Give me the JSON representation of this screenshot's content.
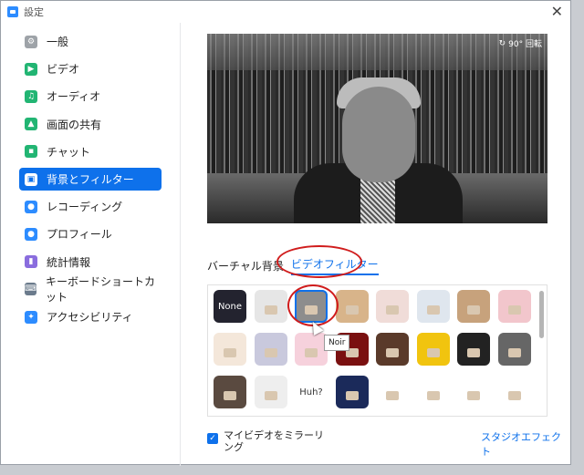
{
  "window": {
    "title": "設定",
    "close_glyph": "✕"
  },
  "sidebar": {
    "items": [
      {
        "label": "一般",
        "icon": "gear-icon",
        "color": "#9ea3a8",
        "glyph": "⚙"
      },
      {
        "label": "ビデオ",
        "icon": "video-camera-icon",
        "color": "#22b573",
        "glyph": "▶"
      },
      {
        "label": "オーディオ",
        "icon": "headphones-icon",
        "color": "#22b573",
        "glyph": "♫"
      },
      {
        "label": "画面の共有",
        "icon": "share-screen-icon",
        "color": "#22b573",
        "glyph": "▲"
      },
      {
        "label": "チャット",
        "icon": "chat-bubble-icon",
        "color": "#22b573",
        "glyph": "▪"
      },
      {
        "label": "背景とフィルター",
        "icon": "background-person-icon",
        "color": "#ffffff",
        "glyph": "▣",
        "active": true
      },
      {
        "label": "レコーディング",
        "icon": "record-icon",
        "color": "#2d8cff",
        "glyph": "●"
      },
      {
        "label": "プロフィール",
        "icon": "profile-icon",
        "color": "#2d8cff",
        "glyph": "●"
      },
      {
        "label": "統計情報",
        "icon": "statistics-icon",
        "color": "#8a6dde",
        "glyph": "▮"
      },
      {
        "label": "キーボードショートカット",
        "icon": "keyboard-icon",
        "color": "#6b7b8c",
        "glyph": "⌨"
      },
      {
        "label": "アクセシビリティ",
        "icon": "accessibility-icon",
        "color": "#2d8cff",
        "glyph": "✦"
      }
    ]
  },
  "preview": {
    "rotate_label": "90° 回転"
  },
  "tabs": {
    "virtual_background": "バーチャル背景",
    "video_filter": "ビデオフィルター"
  },
  "filters": {
    "tooltip": "Noir",
    "tiles": [
      {
        "label": "None",
        "bg": "#23232f",
        "fg": "#ffffff"
      },
      {
        "label": "",
        "bg": "#e6e6e6"
      },
      {
        "label": "",
        "bg": "#8d8d8d",
        "selected": true
      },
      {
        "label": "",
        "bg": "#d8b48a"
      },
      {
        "label": "",
        "bg": "#f0dcd8"
      },
      {
        "label": "",
        "bg": "#dfe6ee"
      },
      {
        "label": "",
        "bg": "#c7a27c"
      },
      {
        "label": "",
        "bg": "#f2c6cc"
      },
      {
        "label": "",
        "bg": "#f4e7da"
      },
      {
        "label": "",
        "bg": "#c9c9dd"
      },
      {
        "label": "",
        "bg": "#f6d1dc"
      },
      {
        "label": "",
        "bg": "#7a1010"
      },
      {
        "label": "",
        "bg": "#5a3a2a"
      },
      {
        "label": "",
        "bg": "#f1c40f"
      },
      {
        "label": "",
        "bg": "#222222"
      },
      {
        "label": "",
        "bg": "#666666"
      },
      {
        "label": "",
        "bg": "#5a4a40"
      },
      {
        "label": "",
        "bg": "#eeeeee"
      },
      {
        "label": "Huh?",
        "bg": "#ffffff",
        "fg": "#333333"
      },
      {
        "label": "",
        "bg": "#1b2a5a"
      },
      {
        "label": "",
        "bg": "#ffffff"
      },
      {
        "label": "",
        "bg": "#ffffff"
      },
      {
        "label": "",
        "bg": "#ffffff"
      },
      {
        "label": "",
        "bg": "#ffffff"
      }
    ]
  },
  "footer": {
    "mirror_label": "マイビデオをミラーリング",
    "mirror_checked": true,
    "studio_effects_link": "スタジオエフェクト"
  }
}
